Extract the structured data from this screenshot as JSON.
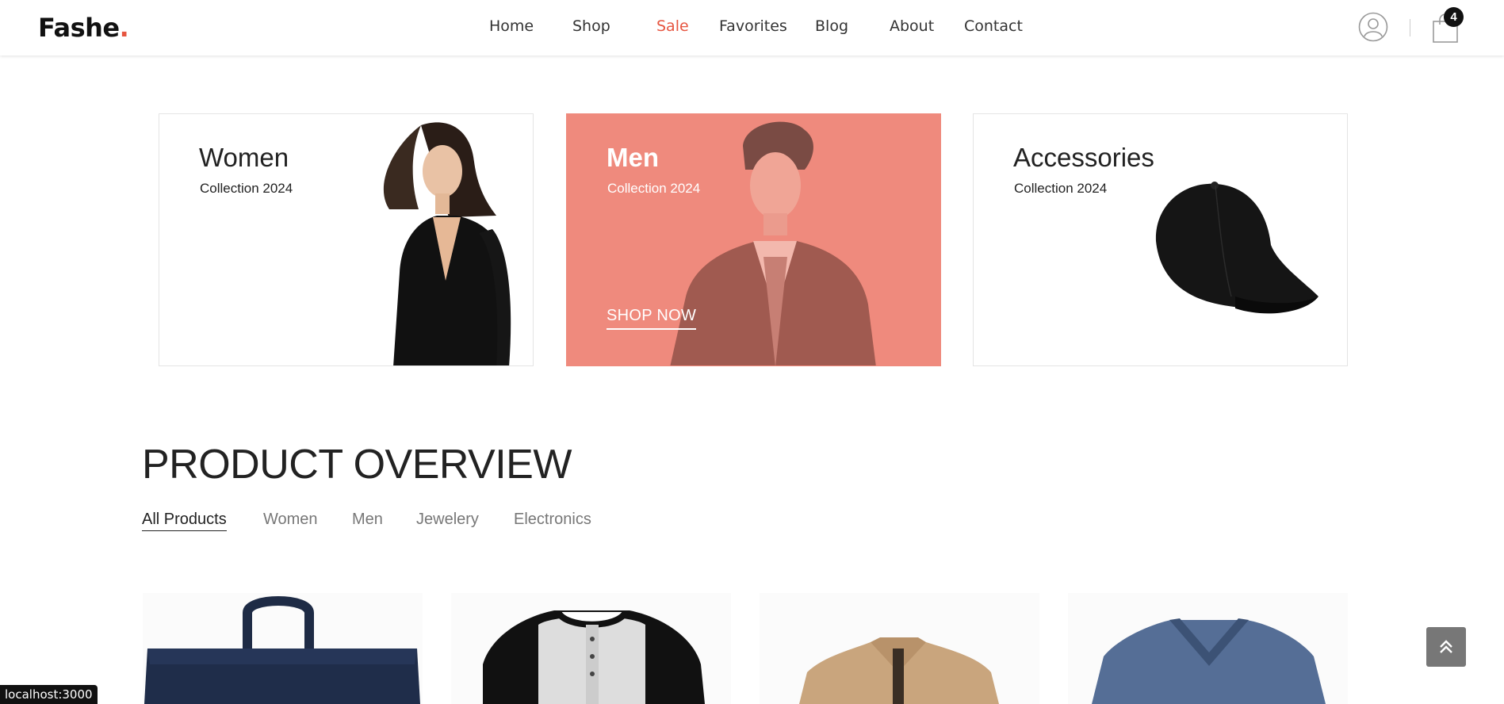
{
  "brand": {
    "name": "Fashe",
    "dot": ".",
    "accent": "#e65540"
  },
  "nav": {
    "items": [
      {
        "label": "Home"
      },
      {
        "label": "Shop"
      },
      {
        "label": "Sale"
      },
      {
        "label": "Favorites"
      },
      {
        "label": "Blog"
      },
      {
        "label": "About"
      },
      {
        "label": "Contact"
      }
    ]
  },
  "header": {
    "user_icon": "user-circle-icon",
    "cart_icon": "shopping-bag-icon",
    "cart_count": "4"
  },
  "banners": [
    {
      "title": "Women",
      "subtitle": "Collection 2024"
    },
    {
      "title": "Men",
      "subtitle": "Collection 2024",
      "cta": "SHOP NOW",
      "overlay_color": "#ef8a7d"
    },
    {
      "title": "Accessories",
      "subtitle": "Collection 2024"
    }
  ],
  "overview": {
    "title": "PRODUCT OVERVIEW",
    "filters": [
      "All Products",
      "Women",
      "Men",
      "Jewelery",
      "Electronics"
    ],
    "active_filter": "All Products"
  },
  "products": [
    {
      "image": "navy-backpack"
    },
    {
      "image": "raglan-henley-shirt"
    },
    {
      "image": "beige-jacket"
    },
    {
      "image": "blue-vneck-tshirt"
    }
  ],
  "back_to_top": {
    "icon": "double-chevron-up-icon"
  },
  "status_bar": {
    "url": "localhost:3000"
  }
}
